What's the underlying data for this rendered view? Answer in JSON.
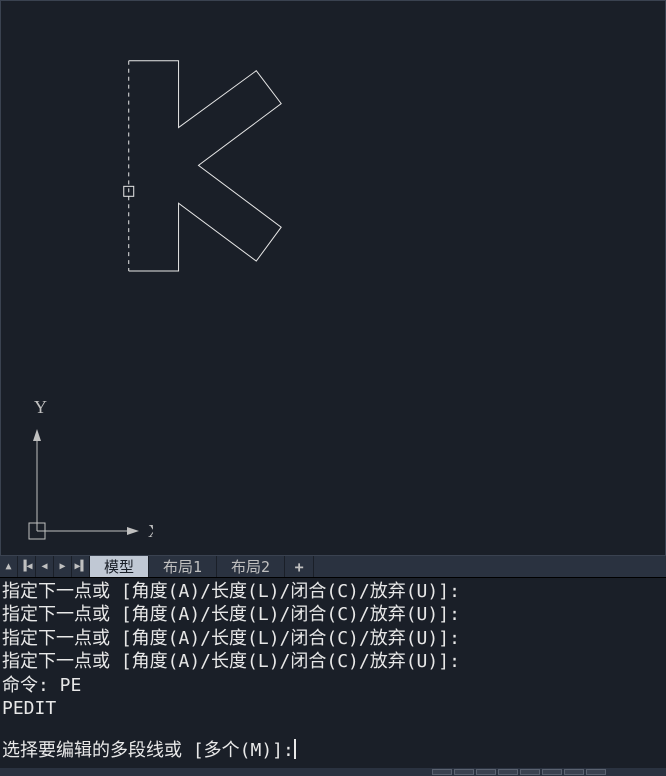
{
  "viewport": {
    "ucs": {
      "x_label": "X",
      "y_label": "Y"
    }
  },
  "tabs": {
    "nav": {
      "up": "▲",
      "first": "▐◀",
      "prev": "◀",
      "next": "▶",
      "last": "▶▌"
    },
    "items": [
      {
        "label": "模型",
        "active": true
      },
      {
        "label": "布局1",
        "active": false
      },
      {
        "label": "布局2",
        "active": false
      }
    ],
    "add": "+"
  },
  "command_history": [
    "指定下一点或 [角度(A)/长度(L)/闭合(C)/放弃(U)]:",
    "指定下一点或 [角度(A)/长度(L)/闭合(C)/放弃(U)]:",
    "指定下一点或 [角度(A)/长度(L)/闭合(C)/放弃(U)]:",
    "指定下一点或 [角度(A)/长度(L)/闭合(C)/放弃(U)]:",
    "命令: PE",
    "PEDIT"
  ],
  "command_prompt": "选择要编辑的多段线或 [多个(M)]:"
}
